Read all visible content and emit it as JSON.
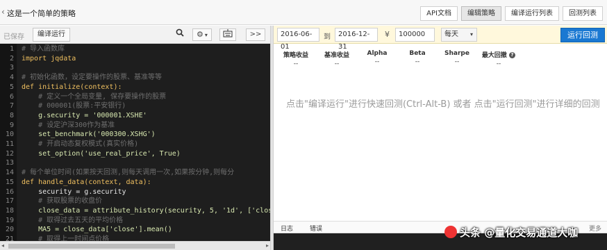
{
  "header": {
    "strategy_title": "这是一个简单的策略",
    "tabs": [
      {
        "label": "API文档"
      },
      {
        "label": "编辑策略",
        "active": true
      },
      {
        "label": "编译运行列表"
      },
      {
        "label": "回测列表"
      }
    ]
  },
  "editor_toolbar": {
    "saved_label": "已保存",
    "compile_label": "编译运行",
    "search_icon": "search-icon",
    "gear_icon": "gear-icon",
    "gear_caret": "▾",
    "keyboard_icon": "keyboard-icon",
    "expand_label": ">>"
  },
  "code": {
    "lines": [
      {
        "n": "1",
        "text": "# 导入函数库"
      },
      {
        "n": "2",
        "text": "import jqdata"
      },
      {
        "n": "3",
        "text": ""
      },
      {
        "n": "4",
        "text": "# 初始化函数，设定要操作的股票、基准等等"
      },
      {
        "n": "5",
        "text": "def initialize(context):"
      },
      {
        "n": "6",
        "text": "    # 定义一个全局变量, 保存要操作的股票"
      },
      {
        "n": "7",
        "text": "    # 000001(股票:平安银行)"
      },
      {
        "n": "8",
        "text": "    g.security = '000001.XSHE'"
      },
      {
        "n": "9",
        "text": "    # 设定沪深300作为基准"
      },
      {
        "n": "10",
        "text": "    set_benchmark('000300.XSHG')"
      },
      {
        "n": "11",
        "text": "    # 开启动态复权模式(真实价格)"
      },
      {
        "n": "12",
        "text": "    set_option('use_real_price', True)"
      },
      {
        "n": "13",
        "text": ""
      },
      {
        "n": "14",
        "text": "# 每个单位时间(如果按天回测,则每天调用一次,如果按分钟,则每分"
      },
      {
        "n": "15",
        "text": "def handle_data(context, data):"
      },
      {
        "n": "16",
        "text": "    security = g.security"
      },
      {
        "n": "17",
        "text": "    # 获取股票的收盘价"
      },
      {
        "n": "18",
        "text": "    close_data = attribute_history(security, 5, '1d', ['clos"
      },
      {
        "n": "19",
        "text": "    # 取得过去五天的平均价格"
      },
      {
        "n": "20",
        "text": "    MA5 = close_data['close'].mean()"
      },
      {
        "n": "21",
        "text": "    # 取得上一时间点价格"
      }
    ]
  },
  "backtest": {
    "start_date": "2016-06-01",
    "to_label": "到",
    "end_date": "2016-12-31",
    "currency_symbol": "¥",
    "capital": "100000",
    "frequency": "每天",
    "run_label": "运行回测"
  },
  "metrics": [
    {
      "label": "策略收益",
      "value": "--"
    },
    {
      "label": "基准收益",
      "value": "--"
    },
    {
      "label": "Alpha",
      "value": "--"
    },
    {
      "label": "Beta",
      "value": "--"
    },
    {
      "label": "Sharpe",
      "value": "--"
    },
    {
      "label": "最大回撤",
      "value": "--",
      "help": "?"
    }
  ],
  "hint_text": "点击\"编译运行\"进行快速回测(Ctrl-Alt-B) 或者 点击\"运行回测\"进行详细的回测",
  "log_panel": {
    "tabs": [
      {
        "label": "日志"
      },
      {
        "label": "错误"
      }
    ],
    "more_label": "更多"
  },
  "watermark": "头条 @量化交易通道大咖",
  "colors": {
    "accent": "#1a78d2",
    "toolbar_bg": "#fff8dc",
    "editor_bg": "#1e1e1e"
  }
}
